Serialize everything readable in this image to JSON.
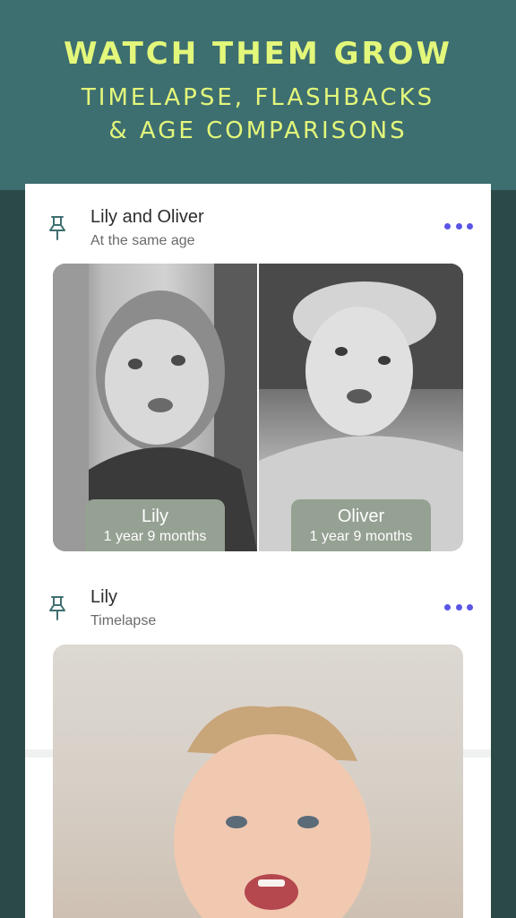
{
  "banner": {
    "title": "WATCH THEM GROW",
    "subtitle_line1": "TIMELAPSE, FLASHBACKS",
    "subtitle_line2": "& AGE COMPARISONS"
  },
  "colors": {
    "banner_bg": "#3d6e70",
    "page_bg": "#2b4a47",
    "headline": "#e3f77a",
    "menu_dots": "#5a55e6",
    "age_label_bg": "#95a192"
  },
  "feed": [
    {
      "title": "Lily and Oliver",
      "subtitle": "At the same age",
      "pin_icon": "pin-icon",
      "menu_icon": "more-dots-icon",
      "comparison": [
        {
          "name": "Lily",
          "age": "1 year 9 months"
        },
        {
          "name": "Oliver",
          "age": "1 year 9 months"
        }
      ]
    },
    {
      "title": "Lily",
      "subtitle": "Timelapse",
      "pin_icon": "pin-icon",
      "menu_icon": "more-dots-icon"
    }
  ]
}
